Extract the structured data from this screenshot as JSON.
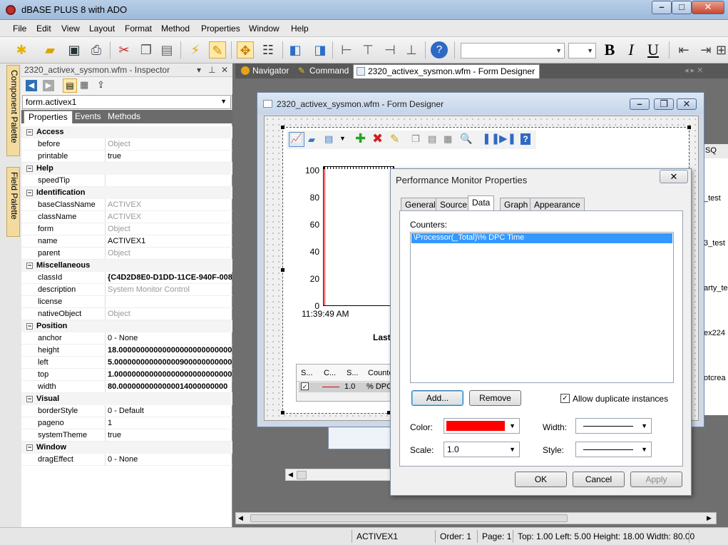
{
  "app": {
    "title": "dBASE PLUS 8 with ADO"
  },
  "menu": [
    "File",
    "Edit",
    "View",
    "Layout",
    "Format",
    "Method",
    "Properties",
    "Window",
    "Help"
  ],
  "toolbar": {
    "bold": "B",
    "italic": "I",
    "underline": "U"
  },
  "palettes": {
    "component": "Component Palette",
    "field": "Field Palette"
  },
  "inspector": {
    "title": "2320_activex_sysmon.wfm - Inspector",
    "pin": "⊥",
    "close": "✕",
    "object": "form.activex1",
    "tabs": [
      "Properties",
      "Events",
      "Methods"
    ],
    "rows": [
      {
        "type": "cat",
        "key": "Access"
      },
      {
        "key": "before",
        "value": "Object",
        "style": "gray"
      },
      {
        "key": "printable",
        "value": "true"
      },
      {
        "type": "cat",
        "key": "Help"
      },
      {
        "key": "speedTip",
        "value": ""
      },
      {
        "type": "cat",
        "key": "Identification"
      },
      {
        "key": "baseClassName",
        "value": "ACTIVEX",
        "style": "gray"
      },
      {
        "key": "className",
        "value": "ACTIVEX",
        "style": "gray"
      },
      {
        "key": "form",
        "value": "Object",
        "style": "gray"
      },
      {
        "key": "name",
        "value": "ACTIVEX1"
      },
      {
        "key": "parent",
        "value": "Object",
        "style": "gray"
      },
      {
        "type": "cat",
        "key": "Miscellaneous"
      },
      {
        "key": "classId",
        "value": "{C4D2D8E0-D1DD-11CE-940F-008",
        "style": "bold"
      },
      {
        "key": "description",
        "value": "System Monitor Control",
        "style": "gray"
      },
      {
        "key": "license",
        "value": ""
      },
      {
        "key": "nativeObject",
        "value": "Object",
        "style": "gray"
      },
      {
        "type": "cat",
        "key": "Position"
      },
      {
        "key": "anchor",
        "value": "0 - None"
      },
      {
        "key": "height",
        "value": "18.00000000000000000000000000",
        "style": "bold"
      },
      {
        "key": "left",
        "value": "5.000000000000000900000000000",
        "style": "bold"
      },
      {
        "key": "top",
        "value": "1.000000000000000000000000000",
        "style": "bold"
      },
      {
        "key": "width",
        "value": "80.0000000000000014000000000",
        "style": "bold"
      },
      {
        "type": "cat",
        "key": "Visual"
      },
      {
        "key": "borderStyle",
        "value": "0 - Default"
      },
      {
        "key": "pageno",
        "value": "1"
      },
      {
        "key": "systemTheme",
        "value": "true"
      },
      {
        "type": "cat",
        "key": "Window"
      },
      {
        "key": "dragEffect",
        "value": "0 - None"
      }
    ]
  },
  "doc_tabs": [
    "Navigator",
    "Command",
    "2320_activex_sysmon.wfm - Form Designer"
  ],
  "form_designer": {
    "title": "2320_activex_sysmon.wfm - Form Designer",
    "chart": {
      "y_ticks": [
        "100",
        "80",
        "60",
        "40",
        "20",
        "0"
      ],
      "time_label": "11:39:49 AM",
      "last_label": "Last",
      "legend_headers": [
        "S...",
        "C...",
        "S...",
        "Counte"
      ],
      "legend_row": {
        "scale": "1.0",
        "counter": "% DPC"
      }
    },
    "right_fragments": [
      "SQ",
      "_test",
      "3_test",
      "arty_te",
      "ex224",
      "otcrea"
    ]
  },
  "dialog": {
    "title": "Performance Monitor Properties",
    "close": "✕",
    "tabs": [
      "General",
      "Source",
      "Data",
      "Graph",
      "Appearance"
    ],
    "active_tab": "Data",
    "counters_label": "Counters:",
    "counters": [
      "\\Processor(_Total)\\% DPC Time"
    ],
    "add_button": "Add...",
    "remove_button": "Remove",
    "allow_duplicates": {
      "label": "Allow duplicate instances",
      "checked": true
    },
    "color_label": "Color:",
    "color_value": "#ff0000",
    "width_label": "Width:",
    "scale_label": "Scale:",
    "scale_value": "1.0",
    "style_label": "Style:",
    "ok": "OK",
    "cancel": "Cancel",
    "apply": "Apply"
  },
  "status": {
    "object": "ACTIVEX1",
    "order": "Order: 1",
    "page": "Page: 1",
    "geometry": "Top: 1.00 Left: 5.00 Height: 18.00 Width: 80.00"
  }
}
